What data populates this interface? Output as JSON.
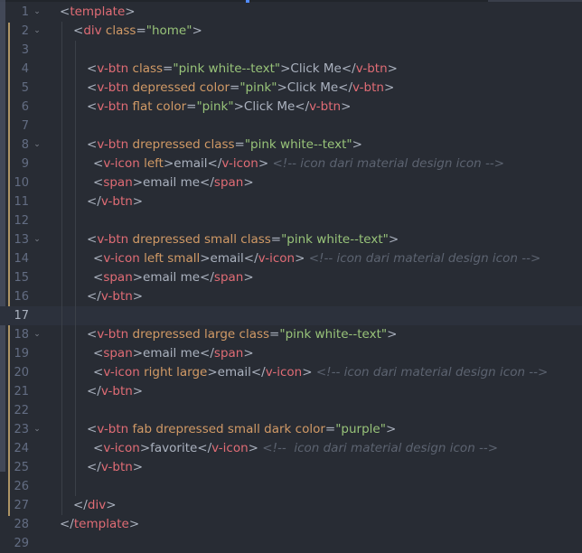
{
  "editor": {
    "language": "vue",
    "cursor_line": 17,
    "colors": {
      "background": "#282c34",
      "tag": "#e06c75",
      "attribute": "#d19a66",
      "string": "#98c379",
      "comment": "#5c6370",
      "text": "#abb2bf",
      "line_number": "#636d83",
      "modified_marker": "#e5c07b"
    },
    "lines": [
      {
        "num": "1",
        "fold": true,
        "indent": 0,
        "tokens": [
          {
            "t": "txt",
            "v": "<"
          },
          {
            "t": "tag",
            "v": "template"
          },
          {
            "t": "txt",
            "v": ">"
          }
        ]
      },
      {
        "num": "2",
        "fold": true,
        "indent": 1,
        "tokens": [
          {
            "t": "txt",
            "v": "<"
          },
          {
            "t": "tag",
            "v": "div"
          },
          {
            "t": "attr",
            "v": " class"
          },
          {
            "t": "txt",
            "v": "="
          },
          {
            "t": "str",
            "v": "\"home\""
          },
          {
            "t": "txt",
            "v": ">"
          }
        ]
      },
      {
        "num": "3",
        "fold": false,
        "indent": 2,
        "tokens": []
      },
      {
        "num": "4",
        "fold": false,
        "indent": 2,
        "tokens": [
          {
            "t": "txt",
            "v": "<"
          },
          {
            "t": "tag",
            "v": "v-btn"
          },
          {
            "t": "attr",
            "v": " class"
          },
          {
            "t": "txt",
            "v": "="
          },
          {
            "t": "str",
            "v": "\"pink white--text\""
          },
          {
            "t": "txt",
            "v": ">Click Me</"
          },
          {
            "t": "tag",
            "v": "v-btn"
          },
          {
            "t": "txt",
            "v": ">"
          }
        ]
      },
      {
        "num": "5",
        "fold": false,
        "indent": 2,
        "tokens": [
          {
            "t": "txt",
            "v": "<"
          },
          {
            "t": "tag",
            "v": "v-btn"
          },
          {
            "t": "attr",
            "v": " depressed color"
          },
          {
            "t": "txt",
            "v": "="
          },
          {
            "t": "str",
            "v": "\"pink\""
          },
          {
            "t": "txt",
            "v": ">Click Me</"
          },
          {
            "t": "tag",
            "v": "v-btn"
          },
          {
            "t": "txt",
            "v": ">"
          }
        ]
      },
      {
        "num": "6",
        "fold": false,
        "indent": 2,
        "tokens": [
          {
            "t": "txt",
            "v": "<"
          },
          {
            "t": "tag",
            "v": "v-btn"
          },
          {
            "t": "attr",
            "v": " flat color"
          },
          {
            "t": "txt",
            "v": "="
          },
          {
            "t": "str",
            "v": "\"pink\""
          },
          {
            "t": "txt",
            "v": ">Click Me</"
          },
          {
            "t": "tag",
            "v": "v-btn"
          },
          {
            "t": "txt",
            "v": ">"
          }
        ]
      },
      {
        "num": "7",
        "fold": false,
        "indent": 2,
        "tokens": []
      },
      {
        "num": "8",
        "fold": true,
        "indent": 2,
        "tokens": [
          {
            "t": "txt",
            "v": "<"
          },
          {
            "t": "tag",
            "v": "v-btn"
          },
          {
            "t": "attr",
            "v": " drepressed class"
          },
          {
            "t": "txt",
            "v": "="
          },
          {
            "t": "str",
            "v": "\"pink white--text\""
          },
          {
            "t": "txt",
            "v": ">"
          }
        ]
      },
      {
        "num": "9",
        "fold": false,
        "indent": 2,
        "extra": 7,
        "tokens": [
          {
            "t": "txt",
            "v": "<"
          },
          {
            "t": "tag",
            "v": "v-icon"
          },
          {
            "t": "attr",
            "v": " left"
          },
          {
            "t": "txt",
            "v": ">email</"
          },
          {
            "t": "tag",
            "v": "v-icon"
          },
          {
            "t": "txt",
            "v": "> "
          },
          {
            "t": "com",
            "v": "<!-- icon dari material design icon -->"
          }
        ]
      },
      {
        "num": "10",
        "fold": false,
        "indent": 2,
        "extra": 7,
        "tokens": [
          {
            "t": "txt",
            "v": "<"
          },
          {
            "t": "tag",
            "v": "span"
          },
          {
            "t": "txt",
            "v": ">email me</"
          },
          {
            "t": "tag",
            "v": "span"
          },
          {
            "t": "txt",
            "v": ">"
          }
        ]
      },
      {
        "num": "11",
        "fold": false,
        "indent": 2,
        "tokens": [
          {
            "t": "txt",
            "v": "</"
          },
          {
            "t": "tag",
            "v": "v-btn"
          },
          {
            "t": "txt",
            "v": ">"
          }
        ]
      },
      {
        "num": "12",
        "fold": false,
        "indent": 2,
        "tokens": []
      },
      {
        "num": "13",
        "fold": true,
        "indent": 2,
        "tokens": [
          {
            "t": "txt",
            "v": "<"
          },
          {
            "t": "tag",
            "v": "v-btn"
          },
          {
            "t": "attr",
            "v": " drepressed small class"
          },
          {
            "t": "txt",
            "v": "="
          },
          {
            "t": "str",
            "v": "\"pink white--text\""
          },
          {
            "t": "txt",
            "v": ">"
          }
        ]
      },
      {
        "num": "14",
        "fold": false,
        "indent": 2,
        "extra": 7,
        "tokens": [
          {
            "t": "txt",
            "v": "<"
          },
          {
            "t": "tag",
            "v": "v-icon"
          },
          {
            "t": "attr",
            "v": " left small"
          },
          {
            "t": "txt",
            "v": ">email</"
          },
          {
            "t": "tag",
            "v": "v-icon"
          },
          {
            "t": "txt",
            "v": "> "
          },
          {
            "t": "com",
            "v": "<!-- icon dari material design icon -->"
          }
        ]
      },
      {
        "num": "15",
        "fold": false,
        "indent": 2,
        "extra": 7,
        "tokens": [
          {
            "t": "txt",
            "v": "<"
          },
          {
            "t": "tag",
            "v": "span"
          },
          {
            "t": "txt",
            "v": ">email me</"
          },
          {
            "t": "tag",
            "v": "span"
          },
          {
            "t": "txt",
            "v": ">"
          }
        ]
      },
      {
        "num": "16",
        "fold": false,
        "indent": 2,
        "tokens": [
          {
            "t": "txt",
            "v": "</"
          },
          {
            "t": "tag",
            "v": "v-btn"
          },
          {
            "t": "txt",
            "v": ">"
          }
        ]
      },
      {
        "num": "17",
        "fold": false,
        "indent": 2,
        "tokens": []
      },
      {
        "num": "18",
        "fold": true,
        "indent": 2,
        "tokens": [
          {
            "t": "txt",
            "v": "<"
          },
          {
            "t": "tag",
            "v": "v-btn"
          },
          {
            "t": "attr",
            "v": " drepressed large class"
          },
          {
            "t": "txt",
            "v": "="
          },
          {
            "t": "str",
            "v": "\"pink white--text\""
          },
          {
            "t": "txt",
            "v": ">"
          }
        ]
      },
      {
        "num": "19",
        "fold": false,
        "indent": 2,
        "extra": 7,
        "tokens": [
          {
            "t": "txt",
            "v": "<"
          },
          {
            "t": "tag",
            "v": "span"
          },
          {
            "t": "txt",
            "v": ">email me</"
          },
          {
            "t": "tag",
            "v": "span"
          },
          {
            "t": "txt",
            "v": ">"
          }
        ]
      },
      {
        "num": "20",
        "fold": false,
        "indent": 2,
        "extra": 7,
        "tokens": [
          {
            "t": "txt",
            "v": "<"
          },
          {
            "t": "tag",
            "v": "v-icon"
          },
          {
            "t": "attr",
            "v": " right large"
          },
          {
            "t": "txt",
            "v": ">email</"
          },
          {
            "t": "tag",
            "v": "v-icon"
          },
          {
            "t": "txt",
            "v": "> "
          },
          {
            "t": "com",
            "v": "<!-- icon dari material design icon -->"
          }
        ]
      },
      {
        "num": "21",
        "fold": false,
        "indent": 2,
        "tokens": [
          {
            "t": "txt",
            "v": "</"
          },
          {
            "t": "tag",
            "v": "v-btn"
          },
          {
            "t": "txt",
            "v": ">"
          }
        ]
      },
      {
        "num": "22",
        "fold": false,
        "indent": 2,
        "tokens": []
      },
      {
        "num": "23",
        "fold": true,
        "indent": 2,
        "tokens": [
          {
            "t": "txt",
            "v": "<"
          },
          {
            "t": "tag",
            "v": "v-btn"
          },
          {
            "t": "attr",
            "v": " fab drepressed small dark color"
          },
          {
            "t": "txt",
            "v": "="
          },
          {
            "t": "str",
            "v": "\"purple\""
          },
          {
            "t": "txt",
            "v": ">"
          }
        ]
      },
      {
        "num": "24",
        "fold": false,
        "indent": 2,
        "extra": 7,
        "tokens": [
          {
            "t": "txt",
            "v": "<"
          },
          {
            "t": "tag",
            "v": "v-icon"
          },
          {
            "t": "txt",
            "v": ">favorite</"
          },
          {
            "t": "tag",
            "v": "v-icon"
          },
          {
            "t": "txt",
            "v": "> "
          },
          {
            "t": "com",
            "v": "<!--  icon dari material design icon -->"
          }
        ]
      },
      {
        "num": "25",
        "fold": false,
        "indent": 2,
        "tokens": [
          {
            "t": "txt",
            "v": "</"
          },
          {
            "t": "tag",
            "v": "v-btn"
          },
          {
            "t": "txt",
            "v": ">"
          }
        ]
      },
      {
        "num": "26",
        "fold": false,
        "indent": 2,
        "tokens": []
      },
      {
        "num": "27",
        "fold": false,
        "indent": 1,
        "tokens": [
          {
            "t": "txt",
            "v": "</"
          },
          {
            "t": "tag",
            "v": "div"
          },
          {
            "t": "txt",
            "v": ">"
          }
        ]
      },
      {
        "num": "28",
        "fold": false,
        "indent": 0,
        "tokens": [
          {
            "t": "txt",
            "v": "</"
          },
          {
            "t": "tag",
            "v": "template"
          },
          {
            "t": "txt",
            "v": ">"
          }
        ]
      },
      {
        "num": "29",
        "fold": false,
        "indent": 0,
        "tokens": []
      }
    ]
  }
}
